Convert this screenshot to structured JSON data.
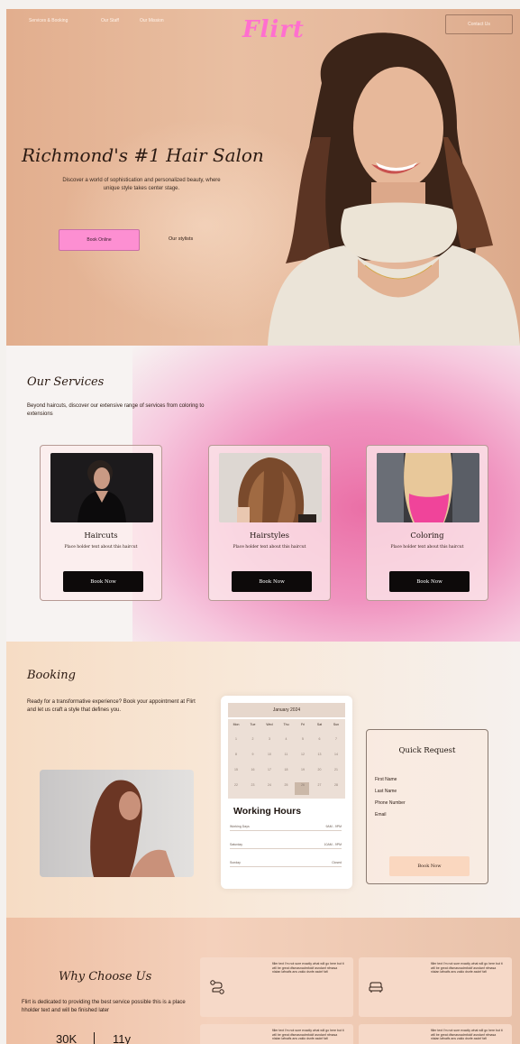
{
  "nav": {
    "links": [
      "Services & Booking",
      "Our Staff",
      "Our Mission"
    ],
    "logo": "Flirt",
    "contact": "Contact Us"
  },
  "hero": {
    "title": "Richmond's #1 Hair Salon",
    "subtitle": "Discover a world of sophistication and personalized beauty, where unique style takes center stage.",
    "book_online": "Book Online",
    "our_stylists": "Our stylists"
  },
  "services": {
    "title": "Our Services",
    "description": "Beyond haircuts, discover our extensive range of services from coloring to extensions",
    "cards": [
      {
        "name": "Haircuts",
        "text": "Place holder text about this haircut",
        "button": "Book Now"
      },
      {
        "name": "Hairstyles",
        "text": "Place holder text about this haircut",
        "button": "Book Now"
      },
      {
        "name": "Coloring",
        "text": "Place holder text about this haircut",
        "button": "Book Now"
      }
    ]
  },
  "booking": {
    "title": "Booking",
    "description": "Ready for a transformative experience? Book your appointment at Flirt and let us craft a style that defines you.",
    "calendar": {
      "month": "January 2024",
      "days": [
        "Mon",
        "Tue",
        "Wed",
        "Thu",
        "Fri",
        "Sat",
        "Sun"
      ],
      "weeks": [
        [
          "1",
          "2",
          "3",
          "4",
          "5",
          "6",
          "7"
        ],
        [
          "8",
          "9",
          "10",
          "11",
          "12",
          "13",
          "14"
        ],
        [
          "15",
          "16",
          "17",
          "18",
          "19",
          "20",
          "21"
        ],
        [
          "22",
          "23",
          "24",
          "25",
          "26",
          "27",
          "28"
        ]
      ]
    },
    "hours_title": "Working Hours",
    "hours": [
      {
        "day": "Working Days",
        "time": "9AM - 9PM"
      },
      {
        "day": "Saturday",
        "time": "10AM - 9PM"
      },
      {
        "day": "Sunday",
        "time": "Closed"
      }
    ],
    "quick_request": {
      "title": "Quick Request",
      "fields": [
        "First Name",
        "Last Name",
        "Phone Number",
        "Email"
      ],
      "button": "Book Now"
    }
  },
  "why": {
    "title": "Why Choose Us",
    "description": "Flirt is dedicated to providing the best service possible this is a place hholder text and will be finished later",
    "stats": [
      "30K",
      "11y"
    ],
    "feature_text": "filler text I'm not sure exactly what will go here but it will be great dfsmasnadmfoidf asndanf nfmasa nlalan lafnaifs ans zaklo dsnfe asdnf fafi",
    "feature_icons": [
      "route-icon",
      "sofa-icon"
    ]
  }
}
